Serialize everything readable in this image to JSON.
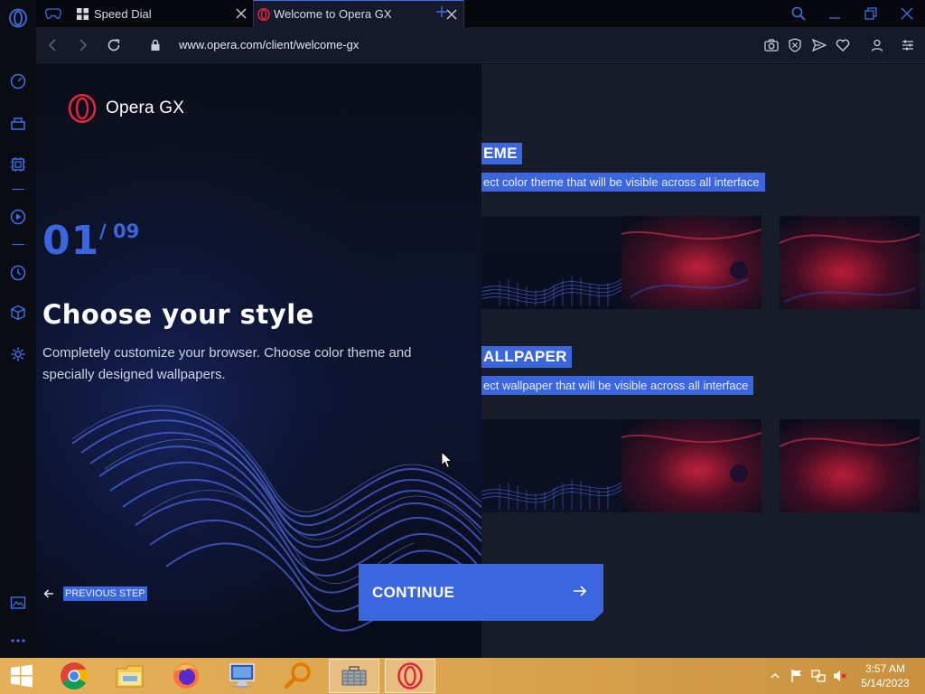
{
  "tabs": [
    {
      "title": "Speed Dial"
    },
    {
      "title": "Welcome to Opera GX"
    }
  ],
  "address": {
    "url": "www.opera.com/client/welcome-gx"
  },
  "welcome": {
    "brand": "Opera GX",
    "step_current": "01",
    "step_total": "/ 09",
    "heading": "Choose your style",
    "description": "Completely customize your browser. Choose color theme and specially designed wallpapers.",
    "previous_label": "PREVIOUS STEP",
    "continue_label": "CONTINUE"
  },
  "settings": {
    "theme_title": "EME",
    "theme_subtitle": "ect color theme that will be visible across all interface",
    "wallpaper_title": "ALLPAPER",
    "wallpaper_subtitle": "ect wallpaper that will be visible across all interface"
  },
  "taskbar": {
    "time": "3:57 AM",
    "date": "5/14/2023"
  },
  "colors": {
    "accent": "#3b66de",
    "opera_red": "#e0263a",
    "panel_bg": "#0b0e1a",
    "page_bg": "#181c28"
  }
}
